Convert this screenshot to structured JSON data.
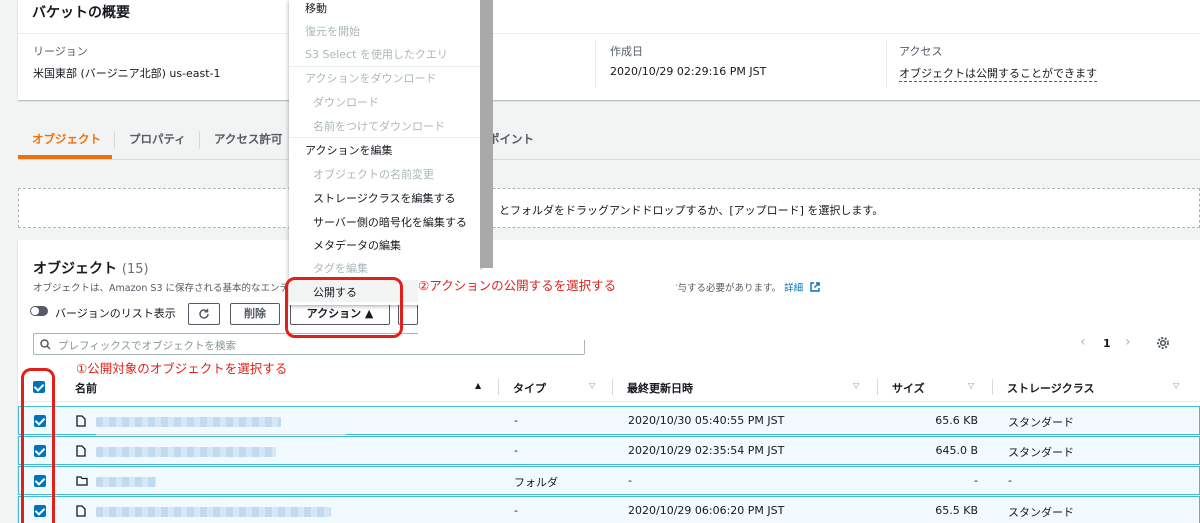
{
  "overview": {
    "title": "バケットの概要",
    "region_label": "リージョン",
    "region_value": "米国東部 (バージニア北部) us-east-1",
    "created_label": "作成日",
    "created_value": "2020/10/29 02:29:16 PM JST",
    "access_label": "アクセス",
    "access_value": "オブジェクトは公開することができます"
  },
  "tabs": [
    "オブジェクト",
    "プロパティ",
    "アクセス許可",
    "ポイント"
  ],
  "dropzone_text": "とフォルダをドラッグアンドドロップするか、[アップロード] を選択します。",
  "objects": {
    "title": "オブジェクト",
    "count": "(15)",
    "desc_left": "オブジェクトは、Amazon S3 に保存される基本的なエンティ",
    "desc_right": "付与する必要があります。",
    "desc_link": "詳細",
    "versions_toggle": "バージョンのリスト表示",
    "delete_label": "削除",
    "actions_label": "アクション ▲",
    "search_placeholder": "プレフィックスでオブジェクトを検索",
    "page_number": "1"
  },
  "columns": [
    "名前",
    "タイプ",
    "最終更新日時",
    "サイズ",
    "ストレージクラス"
  ],
  "rows": [
    {
      "type": "-",
      "modified": "2020/10/30 05:40:55 PM JST",
      "size": "65.6 KB",
      "storage": "スタンダード"
    },
    {
      "type": "-",
      "modified": "2020/10/29 02:35:54 PM JST",
      "size": "645.0 B",
      "storage": "スタンダード"
    },
    {
      "type": "フォルダ",
      "modified": "-",
      "size": "-",
      "storage": "-"
    },
    {
      "type": "-",
      "modified": "2020/10/29 06:06:20 PM JST",
      "size": "65.5 KB",
      "storage": "スタンダード"
    }
  ],
  "menu": {
    "move": "移動",
    "restore": "復元を開始",
    "s3select": "S3 Select を使用したクエリ",
    "download_head": "アクションをダウンロード",
    "download": "ダウンロード",
    "download_as": "名前をつけてダウンロード",
    "edit_head": "アクションを編集",
    "rename": "オブジェクトの名前変更",
    "edit_storage": "ストレージクラスを編集する",
    "edit_encryption": "サーバー側の暗号化を編集する",
    "edit_metadata": "メタデータの編集",
    "edit_tags": "タグを編集",
    "publish": "公開する"
  },
  "annotations": {
    "step1": "①公開対象のオブジェクトを選択する",
    "step2": "②アクションの公開するを選択する",
    "color": "#e0211b"
  }
}
